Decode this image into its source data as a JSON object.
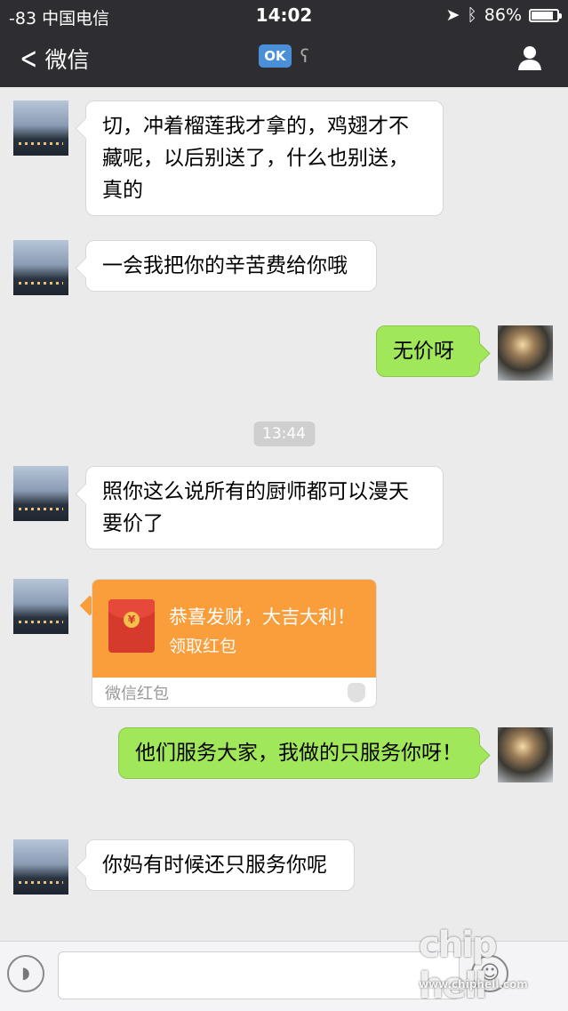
{
  "status_bar": {
    "signal": "-83 中国电信",
    "time": "14:02",
    "battery": "86%",
    "battery_level": 0.86
  },
  "nav": {
    "back_label": "微信",
    "badge": "OK"
  },
  "messages": [
    {
      "side": "left",
      "text": "切，冲着榴莲我才拿的，鸡翅才不藏呢，以后别送了，什么也别送，真的"
    },
    {
      "side": "left",
      "text": "一会我把你的辛苦费给你哦"
    },
    {
      "side": "right",
      "text": "无价呀"
    },
    {
      "side": "left",
      "text": "照你这么说所有的厨师都可以漫天要价了"
    },
    {
      "side": "right",
      "text": "他们服务大家，我做的只服务你呀！"
    },
    {
      "side": "left",
      "text": "你妈有时候还只服务你呢"
    }
  ],
  "timestamp": "13:44",
  "red_packet": {
    "title": "恭喜发财，大吉大利！",
    "subtitle": "领取红包",
    "footer": "微信红包",
    "coin": "¥"
  },
  "input_bar": {
    "voice_icon": "voice-icon",
    "emoji_icon": "emoji-icon"
  },
  "watermark": {
    "brand": "chip hell",
    "url": "www.chiphell.com"
  }
}
